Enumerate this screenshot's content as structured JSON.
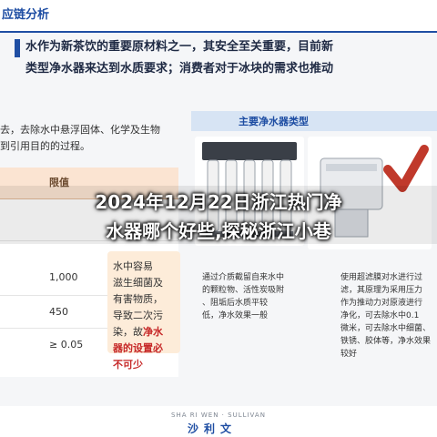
{
  "slide": {
    "top_title": "应链分析",
    "headline_lines": [
      "水作为新茶饮的重要原材料之一，其安全至关重要，目前新",
      "类型净水器来达到水质要求；消费者对于冰块的需求也推动"
    ],
    "intro_lines": [
      "去，去除水中悬浮固体、化学及生物",
      "到引用目的的过程。"
    ],
    "table": {
      "header": "限值",
      "values": [
        "1,000",
        "450",
        "≥ 0.05"
      ]
    },
    "risk_note": {
      "lines": [
        "水中容易",
        "滋生细菌及",
        "有害物质，",
        "导致二次污",
        "染，故"
      ],
      "highlight_inline": "净水",
      "highlight_lines": [
        "器的设置必",
        "不可少"
      ]
    },
    "types_panel": {
      "title": "主要净水器类型",
      "products": [
        {
          "desc_lines": [
            "通过介质截留自来水中",
            "的颗粒物、活性炭吸附",
            "、阻垢后水质平较",
            "低，净水效果一般"
          ]
        },
        {
          "desc_lines": [
            "使用超滤膜对水进行过",
            "滤，其原理为采用压力",
            "作为推动力对原液进行",
            "净化，可去除水中0.1",
            "微米，可去除水中细菌、",
            "铁锈、胶体等，净水效果",
            "较好"
          ]
        }
      ]
    },
    "brand": {
      "subtitle": "SHA RI WEN · SULLIVAN",
      "name": "沙利文"
    },
    "overlay_lines": [
      "2024年12月22日浙江热门净",
      "水器哪个好些,探秘浙江小巷"
    ]
  },
  "colors": {
    "brand_blue": "#1f4ea3",
    "risk_red": "#c62828",
    "check_red": "#c0392b",
    "table_header": "#fbe4d2"
  }
}
